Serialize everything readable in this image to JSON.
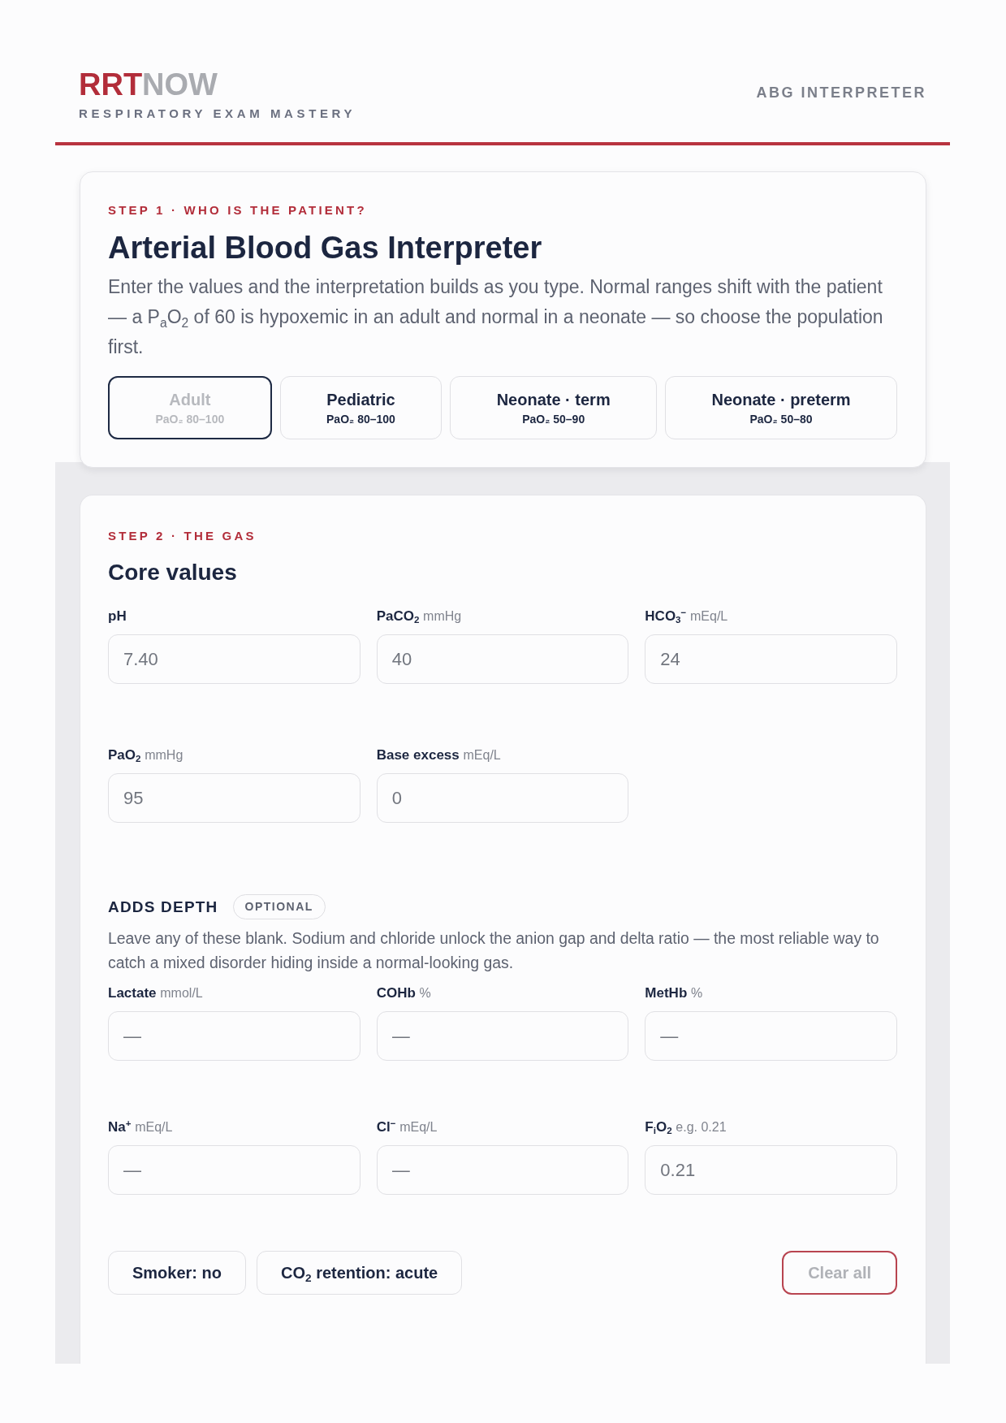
{
  "header": {
    "brand": {
      "primary": "RRT",
      "secondary": "NOW"
    },
    "tagline": "RESPIRATORY EXAM MASTERY",
    "section": "ABG INTERPRETER"
  },
  "patient_step": {
    "step_label": "STEP 1 · WHO IS THE PATIENT?",
    "title": "Arterial Blood Gas Interpreter",
    "intro": "Enter the values and the interpretation builds as you type. Normal ranges shift with the patient — a P$_{a}$O$_{2}$ of 60 is hypoxemic in an adult and normal in a neonate — so choose the population first.",
    "populations": [
      {
        "label": "Adult",
        "range": "PaO₂ 80–100",
        "selected": true
      },
      {
        "label": "Pediatric",
        "range": "PaO₂ 80–100",
        "selected": false
      },
      {
        "label": "Neonate · term",
        "range": "PaO₂ 50–90",
        "selected": false
      },
      {
        "label": "Neonate · preterm",
        "range": "PaO₂ 50–80",
        "selected": false
      }
    ]
  },
  "gas_step": {
    "step_label": "STEP 2 · THE GAS",
    "title": "Core values",
    "core_fields": [
      {
        "label": "pH",
        "placeholder": "7.40"
      },
      {
        "label": "PaCO$_{2}$",
        "unit": "mmHg",
        "placeholder": "40"
      },
      {
        "label": "HCO$_{3}$$^{−}$",
        "unit": "mEq/L",
        "placeholder": "24"
      },
      {
        "label": "PaO$_{2}$",
        "unit": "mmHg",
        "placeholder": "95"
      },
      {
        "label": "Base excess",
        "unit": "mEq/L",
        "placeholder": "0"
      }
    ],
    "depth": {
      "title": "ADDS DEPTH",
      "badge": "OPTIONAL",
      "note": "Leave any of these blank. Sodium and chloride unlock the anion gap and delta ratio — the most reliable way to catch a mixed disorder hiding inside a normal-looking gas.",
      "fields": [
        {
          "label": "Lactate",
          "unit": "mmol/L",
          "placeholder": "—"
        },
        {
          "label": "COHb",
          "unit": "%",
          "placeholder": "—"
        },
        {
          "label": "MetHb",
          "unit": "%",
          "placeholder": "—"
        },
        {
          "label": "Na$^{+}$",
          "unit": "mEq/L",
          "placeholder": "—"
        },
        {
          "label": "Cl$^{−}$",
          "unit": "mEq/L",
          "placeholder": "—"
        },
        {
          "label": "F$_{i}$O$_{2}$",
          "unit": "e.g. 0.21",
          "placeholder": "0.21"
        }
      ]
    },
    "toggles": [
      "Smoker: no",
      "CO$_{2}$ retention: acute"
    ],
    "clear_button": "Clear all"
  }
}
